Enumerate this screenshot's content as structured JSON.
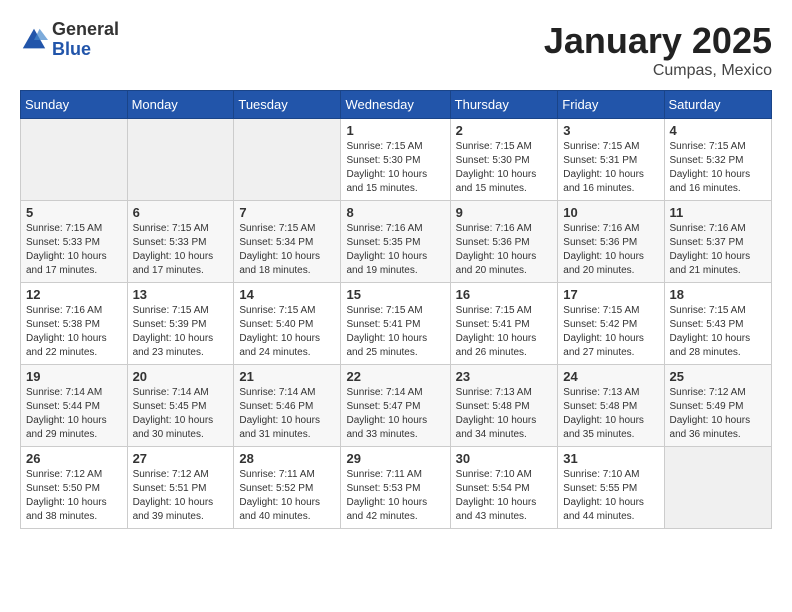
{
  "header": {
    "logo_general": "General",
    "logo_blue": "Blue",
    "title": "January 2025",
    "subtitle": "Cumpas, Mexico"
  },
  "weekdays": [
    "Sunday",
    "Monday",
    "Tuesday",
    "Wednesday",
    "Thursday",
    "Friday",
    "Saturday"
  ],
  "weeks": [
    [
      {
        "day": "",
        "info": ""
      },
      {
        "day": "",
        "info": ""
      },
      {
        "day": "",
        "info": ""
      },
      {
        "day": "1",
        "info": "Sunrise: 7:15 AM\nSunset: 5:30 PM\nDaylight: 10 hours\nand 15 minutes."
      },
      {
        "day": "2",
        "info": "Sunrise: 7:15 AM\nSunset: 5:30 PM\nDaylight: 10 hours\nand 15 minutes."
      },
      {
        "day": "3",
        "info": "Sunrise: 7:15 AM\nSunset: 5:31 PM\nDaylight: 10 hours\nand 16 minutes."
      },
      {
        "day": "4",
        "info": "Sunrise: 7:15 AM\nSunset: 5:32 PM\nDaylight: 10 hours\nand 16 minutes."
      }
    ],
    [
      {
        "day": "5",
        "info": "Sunrise: 7:15 AM\nSunset: 5:33 PM\nDaylight: 10 hours\nand 17 minutes."
      },
      {
        "day": "6",
        "info": "Sunrise: 7:15 AM\nSunset: 5:33 PM\nDaylight: 10 hours\nand 17 minutes."
      },
      {
        "day": "7",
        "info": "Sunrise: 7:15 AM\nSunset: 5:34 PM\nDaylight: 10 hours\nand 18 minutes."
      },
      {
        "day": "8",
        "info": "Sunrise: 7:16 AM\nSunset: 5:35 PM\nDaylight: 10 hours\nand 19 minutes."
      },
      {
        "day": "9",
        "info": "Sunrise: 7:16 AM\nSunset: 5:36 PM\nDaylight: 10 hours\nand 20 minutes."
      },
      {
        "day": "10",
        "info": "Sunrise: 7:16 AM\nSunset: 5:36 PM\nDaylight: 10 hours\nand 20 minutes."
      },
      {
        "day": "11",
        "info": "Sunrise: 7:16 AM\nSunset: 5:37 PM\nDaylight: 10 hours\nand 21 minutes."
      }
    ],
    [
      {
        "day": "12",
        "info": "Sunrise: 7:16 AM\nSunset: 5:38 PM\nDaylight: 10 hours\nand 22 minutes."
      },
      {
        "day": "13",
        "info": "Sunrise: 7:15 AM\nSunset: 5:39 PM\nDaylight: 10 hours\nand 23 minutes."
      },
      {
        "day": "14",
        "info": "Sunrise: 7:15 AM\nSunset: 5:40 PM\nDaylight: 10 hours\nand 24 minutes."
      },
      {
        "day": "15",
        "info": "Sunrise: 7:15 AM\nSunset: 5:41 PM\nDaylight: 10 hours\nand 25 minutes."
      },
      {
        "day": "16",
        "info": "Sunrise: 7:15 AM\nSunset: 5:41 PM\nDaylight: 10 hours\nand 26 minutes."
      },
      {
        "day": "17",
        "info": "Sunrise: 7:15 AM\nSunset: 5:42 PM\nDaylight: 10 hours\nand 27 minutes."
      },
      {
        "day": "18",
        "info": "Sunrise: 7:15 AM\nSunset: 5:43 PM\nDaylight: 10 hours\nand 28 minutes."
      }
    ],
    [
      {
        "day": "19",
        "info": "Sunrise: 7:14 AM\nSunset: 5:44 PM\nDaylight: 10 hours\nand 29 minutes."
      },
      {
        "day": "20",
        "info": "Sunrise: 7:14 AM\nSunset: 5:45 PM\nDaylight: 10 hours\nand 30 minutes."
      },
      {
        "day": "21",
        "info": "Sunrise: 7:14 AM\nSunset: 5:46 PM\nDaylight: 10 hours\nand 31 minutes."
      },
      {
        "day": "22",
        "info": "Sunrise: 7:14 AM\nSunset: 5:47 PM\nDaylight: 10 hours\nand 33 minutes."
      },
      {
        "day": "23",
        "info": "Sunrise: 7:13 AM\nSunset: 5:48 PM\nDaylight: 10 hours\nand 34 minutes."
      },
      {
        "day": "24",
        "info": "Sunrise: 7:13 AM\nSunset: 5:48 PM\nDaylight: 10 hours\nand 35 minutes."
      },
      {
        "day": "25",
        "info": "Sunrise: 7:12 AM\nSunset: 5:49 PM\nDaylight: 10 hours\nand 36 minutes."
      }
    ],
    [
      {
        "day": "26",
        "info": "Sunrise: 7:12 AM\nSunset: 5:50 PM\nDaylight: 10 hours\nand 38 minutes."
      },
      {
        "day": "27",
        "info": "Sunrise: 7:12 AM\nSunset: 5:51 PM\nDaylight: 10 hours\nand 39 minutes."
      },
      {
        "day": "28",
        "info": "Sunrise: 7:11 AM\nSunset: 5:52 PM\nDaylight: 10 hours\nand 40 minutes."
      },
      {
        "day": "29",
        "info": "Sunrise: 7:11 AM\nSunset: 5:53 PM\nDaylight: 10 hours\nand 42 minutes."
      },
      {
        "day": "30",
        "info": "Sunrise: 7:10 AM\nSunset: 5:54 PM\nDaylight: 10 hours\nand 43 minutes."
      },
      {
        "day": "31",
        "info": "Sunrise: 7:10 AM\nSunset: 5:55 PM\nDaylight: 10 hours\nand 44 minutes."
      },
      {
        "day": "",
        "info": ""
      }
    ]
  ]
}
